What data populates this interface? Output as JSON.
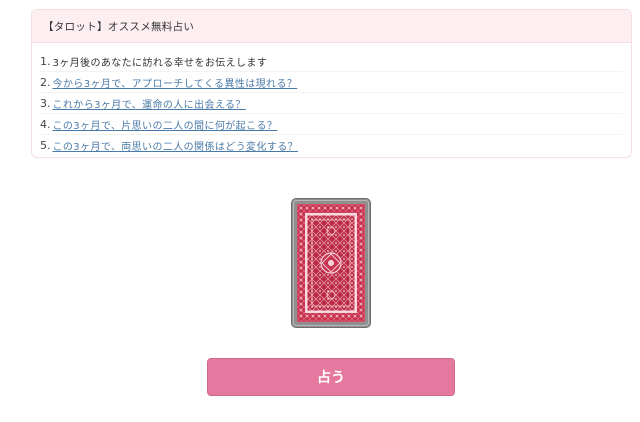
{
  "panel": {
    "title": "【タロット】オススメ無料占い",
    "items": [
      {
        "number": "1.",
        "text": "3ヶ月後のあなたに訪れる幸せをお伝えします"
      },
      {
        "number": "2.",
        "text": "今から3ヶ月で、アプローチしてくる異性は現れる？"
      },
      {
        "number": "3.",
        "text": "これから3ヶ月で、運命の人に出会える？"
      },
      {
        "number": "4.",
        "text": "この3ヶ月で、片思いの二人の間に何が起こる？"
      },
      {
        "number": "5.",
        "text": "この3ヶ月で、両思いの二人の関係はどう変化する？"
      }
    ]
  },
  "card": {
    "icon": "tarot-card-back-icon",
    "colors": {
      "frame": "#8e8e8e",
      "back": "#c8334f",
      "pattern": "#f4c7cf"
    }
  },
  "button": {
    "label": "占う",
    "color": "#e5789f"
  }
}
